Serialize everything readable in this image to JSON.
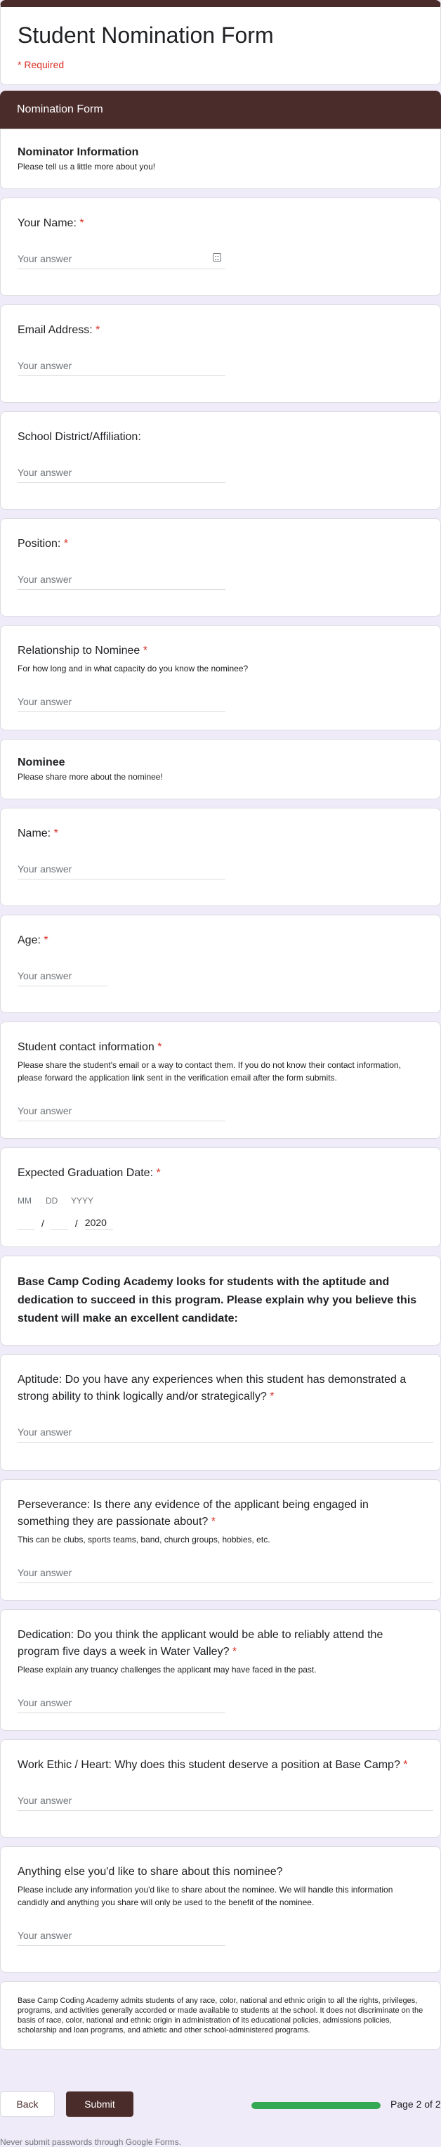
{
  "header": {
    "title": "Student Nomination Form",
    "required_note": "* Required"
  },
  "section_banner": "Nomination Form",
  "nominator_section": {
    "title": "Nominator Information",
    "description": "Please tell us a little more about you!"
  },
  "placeholder": "Your answer",
  "questions_a": [
    {
      "title": "Your Name:",
      "required": true,
      "desc": ""
    },
    {
      "title": "Email Address:",
      "required": true,
      "desc": ""
    },
    {
      "title": "School District/Affiliation:",
      "required": false,
      "desc": ""
    },
    {
      "title": "Position:",
      "required": true,
      "desc": ""
    },
    {
      "title": "Relationship to Nominee",
      "required": true,
      "desc": "For how long and in what capacity do you know the nominee?"
    }
  ],
  "nominee_section": {
    "title": "Nominee",
    "description": "Please share more about the nominee!"
  },
  "questions_b": [
    {
      "title": "Name:",
      "required": true,
      "desc": ""
    },
    {
      "title": "Age:",
      "required": true,
      "desc": ""
    },
    {
      "title": "Student contact information",
      "required": true,
      "desc": "Please share the student's email or a way to contact them. If you do not know their contact information, please forward the application link sent in the verification email after the form submits."
    }
  ],
  "graduation": {
    "title": "Expected Graduation Date:",
    "required": true,
    "labels": [
      "MM",
      "DD",
      "YYYY"
    ],
    "year_value": "2020"
  },
  "statement": "Base Camp Coding Academy looks for students with the aptitude and dedication to succeed in this program. Please explain why you believe this student will make an excellent candidate:",
  "questions_c": [
    {
      "title": "Aptitude: Do you have any experiences when this student has demonstrated a strong ability to think logically and/or strategically?",
      "required": true,
      "desc": ""
    },
    {
      "title": "Perseverance: Is there any evidence of the applicant being engaged in something they are passionate about?",
      "required": true,
      "desc": "This can be clubs, sports teams, band, church groups, hobbies, etc."
    },
    {
      "title": "Dedication: Do you think the applicant would be able to reliably attend the program five days a week in Water Valley?",
      "required": true,
      "desc": "Please explain any truancy challenges the applicant may have faced in the past."
    },
    {
      "title": "Work Ethic / Heart: Why does this student deserve a position at Base Camp?",
      "required": true,
      "desc": ""
    },
    {
      "title": "Anything else you'd like to share about this nominee?",
      "required": false,
      "desc": "Please include any information you'd like to share about the nominee. We will handle this information candidly and anything you share will only be used to the benefit of the nominee."
    }
  ],
  "legal_text": "Base Camp Coding Academy admits students of any race, color, national and ethnic origin to all the rights, privileges, programs, and activities generally accorded or made available to students at the school.  It does not discriminate on the basis of race, color, national and ethnic origin in administration of its educational policies, admissions policies, scholarship and loan programs, and athletic and other school-administered programs.",
  "nav": {
    "back_label": "Back",
    "submit_label": "Submit",
    "progress_fraction": 1.0,
    "page_count": "Page 2 of 2"
  },
  "footer_note": "Never submit passwords through Google Forms.",
  "colors": {
    "theme": "#4a2c2a",
    "required": "#d93025",
    "progress": "#34a853"
  }
}
